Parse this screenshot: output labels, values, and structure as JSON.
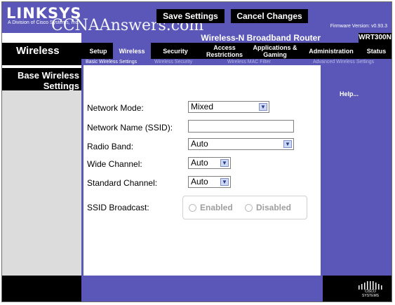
{
  "brand": {
    "logo": "LINKSYS",
    "subtitle": "A Division of Cisco Systems, Inc.",
    "watermark": "CCNAAnswers.com",
    "firmware": "Firmware Version: v0.93.3"
  },
  "product": {
    "name": "Wireless-N Broadband Router",
    "model": "WRT300N"
  },
  "section_title": "Wireless",
  "nav": {
    "tabs": [
      {
        "label": "Setup",
        "active": false
      },
      {
        "label": "Wireless",
        "active": true
      },
      {
        "label": "Security",
        "active": false
      },
      {
        "label": "Access Restrictions",
        "active": false
      },
      {
        "label": "Applications & Gaming",
        "active": false
      },
      {
        "label": "Administration",
        "active": false
      },
      {
        "label": "Status",
        "active": false
      }
    ],
    "subtabs": [
      {
        "label": "Basic Wireless Settings",
        "active": true
      },
      {
        "label": "Wireless Security",
        "active": false
      },
      {
        "label": "Wireless MAC Filter",
        "active": false
      },
      {
        "label": "Advanced Wireless Settings",
        "active": false
      }
    ]
  },
  "left_panel": {
    "heading": "Base Wireless Settings"
  },
  "form": {
    "network_mode": {
      "label": "Network Mode:",
      "value": "Mixed"
    },
    "ssid": {
      "label": "Network Name (SSID):",
      "value": ""
    },
    "radio_band": {
      "label": "Radio Band:",
      "value": "Auto"
    },
    "wide_channel": {
      "label": "Wide Channel:",
      "value": "Auto"
    },
    "standard_channel": {
      "label": "Standard Channel:",
      "value": "Auto"
    },
    "ssid_broadcast": {
      "label": "SSID Broadcast:",
      "options": [
        "Enabled",
        "Disabled"
      ]
    }
  },
  "help": "Help...",
  "buttons": {
    "save": "Save Settings",
    "cancel": "Cancel Changes"
  },
  "footer_logo": "CISCO SYSTEMS",
  "colors": {
    "brand_purple": "#5a57b8",
    "black": "#000000",
    "grey_panel": "#dcdcdc"
  }
}
